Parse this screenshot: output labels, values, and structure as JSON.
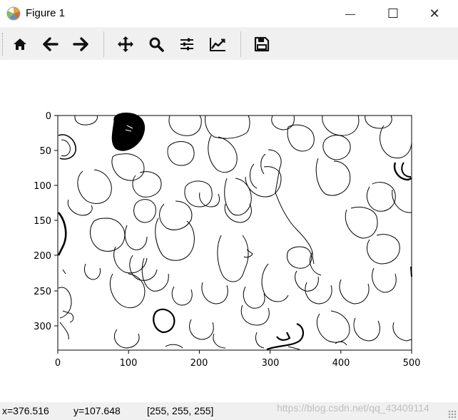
{
  "window": {
    "title": "Figure 1",
    "minimize_glyph": "—",
    "maximize_glyph": "☐",
    "close_glyph": "✕"
  },
  "toolbar": {
    "buttons": [
      {
        "name": "home",
        "icon": "home-icon"
      },
      {
        "name": "back",
        "icon": "arrow-left-icon"
      },
      {
        "name": "forward",
        "icon": "arrow-right-icon"
      },
      {
        "name": "pan",
        "icon": "move-icon"
      },
      {
        "name": "zoom",
        "icon": "magnifier-icon"
      },
      {
        "name": "configure-subplots",
        "icon": "sliders-icon"
      },
      {
        "name": "edit-axes",
        "icon": "line-chart-icon"
      },
      {
        "name": "save",
        "icon": "floppy-disk-icon"
      }
    ]
  },
  "chart_data": {
    "type": "image",
    "description": "binary edge-contour image",
    "x_ticks": [
      0,
      100,
      200,
      300,
      400,
      500
    ],
    "y_ticks": [
      0,
      50,
      100,
      150,
      200,
      250,
      300
    ],
    "xlim": [
      0,
      500
    ],
    "ylim": [
      335,
      0
    ]
  },
  "status": {
    "x_readout": "x=376.516",
    "y_readout": "y=107.648",
    "pixel_value": "[255, 255, 255]"
  },
  "watermark": "https://blog.csdn.net/qq_43409114"
}
